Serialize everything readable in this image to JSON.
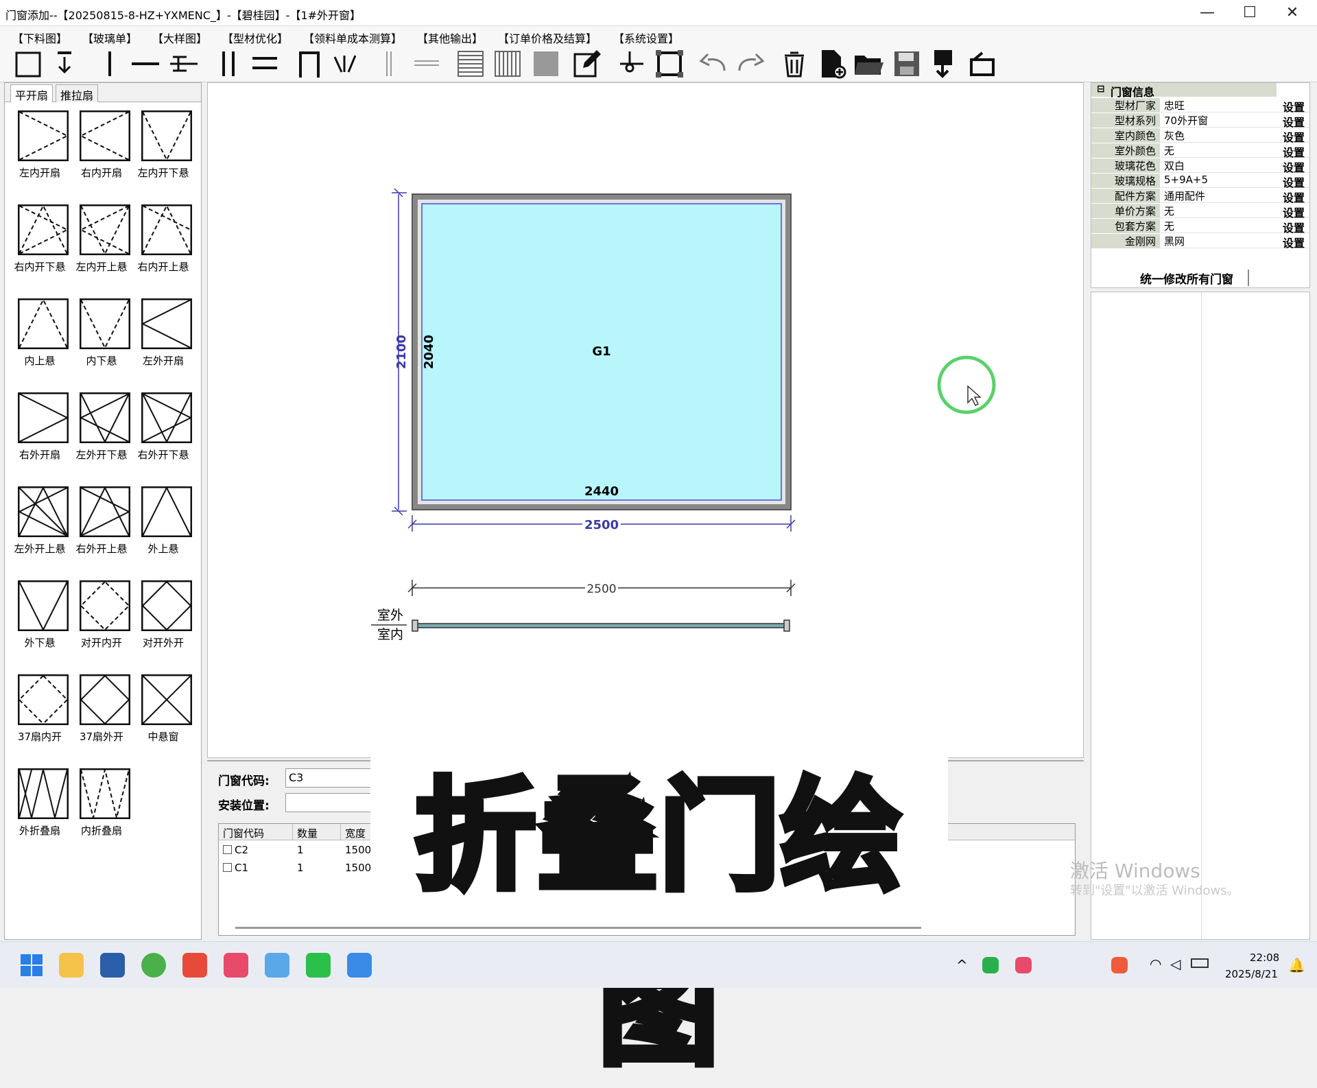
{
  "window": {
    "title": "门窗添加--【20250815-8-HZ+YXMENC_】-【碧桂园】-【1#外开窗】",
    "minimize": "—",
    "maximize": "☐",
    "close": "✕"
  },
  "menu": [
    "【下料图】",
    "【玻璃单】",
    "【大样图】",
    "【型材优化】",
    "【领料单成本测算】",
    "【其他输出】",
    "【订单价格及结算】",
    "【系统设置】"
  ],
  "toolbar": {
    "tools": [
      "frame-tool",
      "down-open-tool",
      "vertical-mullion-tool",
      "horizontal-mullion-tool",
      "tee-mullion-tool",
      "double-vertical-tool",
      "double-horizontal-tool",
      "arch-tool",
      "fan-tool",
      "vertical-bar-tool",
      "horizontal-bar-tool",
      "hatch-horizontal-tool",
      "hatch-vertical-tool",
      "fill-tool",
      "edit-tool",
      "corner-tool",
      "select-frame-tool",
      "undo",
      "redo",
      "delete",
      "new-file",
      "open-folder",
      "save",
      "import",
      "exit"
    ]
  },
  "left_panel": {
    "tabs": [
      "平开扇",
      "推拉扇"
    ],
    "sashes": [
      [
        "左内开扇",
        "右内开扇",
        "左内开下悬"
      ],
      [
        "右内开下悬",
        "左内开上悬",
        "右内开上悬"
      ],
      [
        "内上悬",
        "内下悬",
        "左外开扇"
      ],
      [
        "右外开扇",
        "左外开下悬",
        "右外开下悬"
      ],
      [
        "左外开上悬",
        "右外开上悬",
        "外上悬"
      ],
      [
        "外下悬",
        "对开内开",
        "对开外开"
      ],
      [
        "37扇内开",
        "37扇外开",
        "中悬窗"
      ],
      [
        "外折叠扇",
        "内折叠扇"
      ]
    ]
  },
  "drawing": {
    "glass_label": "G1",
    "height_outer": "2100",
    "height_inner": "2040",
    "width_inner": "2440",
    "width_outer": "2500",
    "plan_width": "2500",
    "outside_label": "室外",
    "inside_label": "室内",
    "glass_color": "#b8f6fc",
    "dim_color": "#3a3aa8",
    "cursor_ring_color": "#5bd06a"
  },
  "info_panel": {
    "header": "门窗信息",
    "rows": [
      {
        "key": "型材厂家",
        "value": "忠旺",
        "btn": "设置"
      },
      {
        "key": "型材系列",
        "value": "70外开窗",
        "btn": "设置"
      },
      {
        "key": "室内颜色",
        "value": "灰色",
        "btn": "设置"
      },
      {
        "key": "室外颜色",
        "value": "无",
        "btn": "设置"
      },
      {
        "key": "玻璃花色",
        "value": "双白",
        "btn": "设置"
      },
      {
        "key": "玻璃规格",
        "value": "5+9A+5",
        "btn": "设置"
      },
      {
        "key": "配件方案",
        "value": "通用配件",
        "btn": "设置"
      },
      {
        "key": "单价方案",
        "value": "无",
        "btn": "设置"
      },
      {
        "key": "包套方案",
        "value": "无",
        "btn": "设置"
      },
      {
        "key": "金刚网",
        "value": "黑网",
        "btn": "设置"
      }
    ],
    "unify_button": "统一修改所有门窗"
  },
  "form": {
    "code_label": "门窗代码:",
    "code_value": "C3",
    "location_label": "安装位置:",
    "location_value": ""
  },
  "table": {
    "headers": [
      "门窗代码",
      "数量",
      "宽度"
    ],
    "rows": [
      [
        "C2",
        "1",
        "1500"
      ],
      [
        "C1",
        "1",
        "1500"
      ]
    ]
  },
  "overlay_caption": "折叠门绘图",
  "watermark": {
    "line1": "激活 Windows",
    "line2": "转到\"设置\"以激活 Windows。"
  },
  "taskbar": {
    "time": "22:08",
    "date": "2025/8/21"
  }
}
